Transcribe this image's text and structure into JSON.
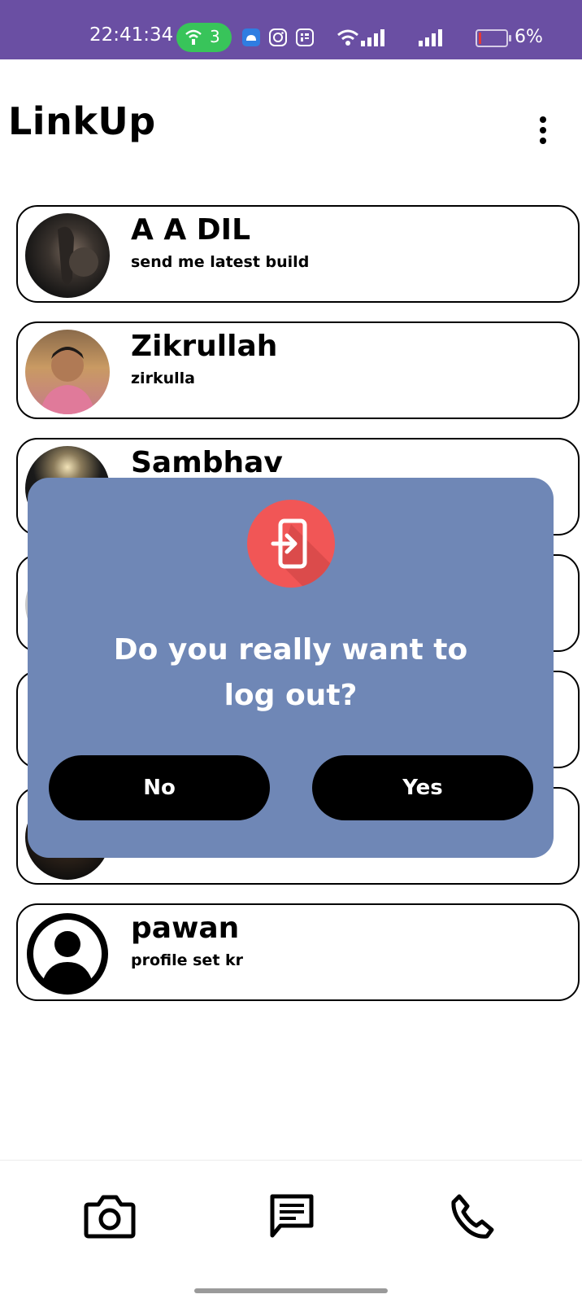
{
  "status_bar": {
    "time": "22:41:34",
    "hotspot_count": "3",
    "battery_percent": "6%",
    "icons": [
      "hotspot-icon",
      "android-icon",
      "instagram-icon",
      "app-icon",
      "wifi-icon",
      "signal-icon",
      "signal-icon",
      "battery-icon"
    ]
  },
  "header": {
    "title": "LinkUp",
    "menu_icon": "more-vert-icon"
  },
  "chats": [
    {
      "name": "A A DIL",
      "message": "send me latest build"
    },
    {
      "name": "Zikrullah",
      "message": "zirkulla"
    },
    {
      "name": "Sambhav",
      "message": ""
    },
    {
      "name": "",
      "message": ""
    },
    {
      "name": "",
      "message": ""
    },
    {
      "name": "",
      "message": ""
    },
    {
      "name": "pawan",
      "message": "profile set kr"
    }
  ],
  "dialog": {
    "icon": "logout-icon",
    "message_line1": "Do you really want to",
    "message_line2": "log out?",
    "no_label": "No",
    "yes_label": "Yes"
  },
  "bottom_nav": {
    "items": [
      "camera-icon",
      "chat-icon",
      "phone-icon"
    ]
  },
  "colors": {
    "status_bar": "#6a4fa3",
    "dialog_bg": "#6f87b6",
    "dialog_icon_bg": "#f15656",
    "hotspot_badge": "#38c45a"
  }
}
